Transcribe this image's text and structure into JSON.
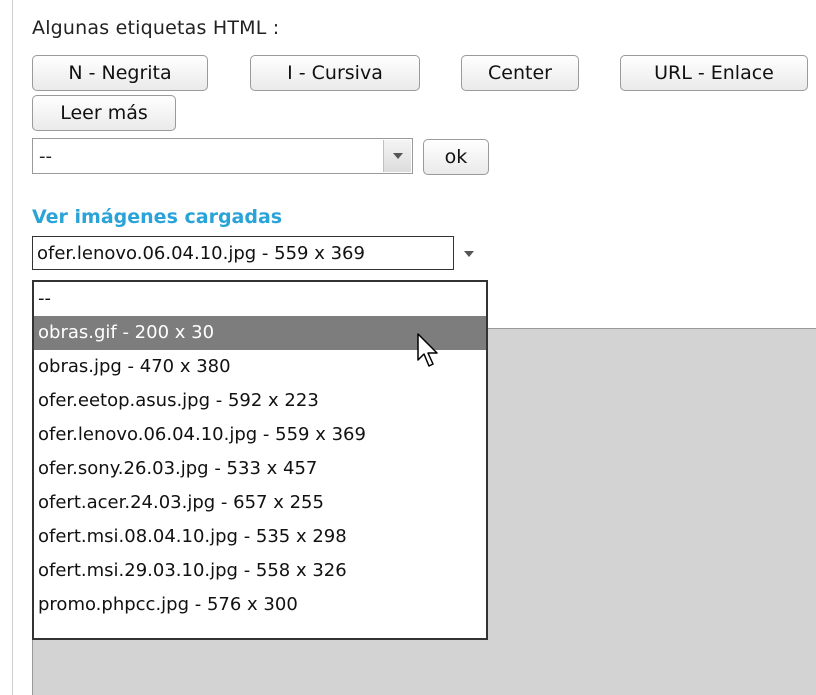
{
  "html_tags_label": "Algunas etiquetas HTML :",
  "tag_buttons": [
    {
      "label": "N - Negrita"
    },
    {
      "label": "I - Cursiva"
    },
    {
      "label": "Center"
    },
    {
      "label": "URL - Enlace"
    },
    {
      "label": "Leer más"
    }
  ],
  "tag_select": {
    "selected": "--"
  },
  "ok_button": "ok",
  "images_link": "Ver imágenes cargadas",
  "image_select": {
    "selected": "ofer.lenovo.06.04.10.jpg - 559 x 369",
    "highlighted_index": 1,
    "options": [
      "--",
      "obras.gif - 200 x 30",
      "obras.jpg - 470 x 380",
      "ofer.eetop.asus.jpg - 592 x 223",
      "ofer.lenovo.06.04.10.jpg - 559 x 369",
      "ofer.sony.26.03.jpg - 533 x 457",
      "ofert.acer.24.03.jpg - 657 x 255",
      "ofert.msi.08.04.10.jpg - 535 x 298",
      "ofert.msi.29.03.10.jpg - 558 x 326",
      "promo.phpcc.jpg - 576 x 300"
    ]
  },
  "colors": {
    "link": "#2aa3d8",
    "highlight": "#7d7d7d",
    "panel": "#d3d3d3"
  }
}
